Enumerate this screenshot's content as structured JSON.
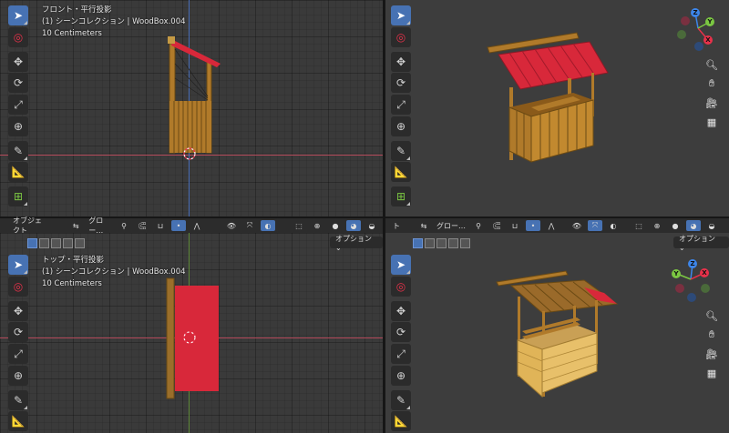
{
  "viewports": {
    "top_left": {
      "view_name": "フロント・平行投影",
      "collection": "(1) シーンコレクション | WoodBox.004",
      "scale": "10 Centimeters"
    },
    "bottom_left": {
      "view_name": "トップ・平行投影",
      "collection": "(1) シーンコレクション | WoodBox.004",
      "scale": "10 Centimeters"
    }
  },
  "header": {
    "mode_label": "オブジェクト",
    "mode_label_short": "ト",
    "orientation_label": "グロー…",
    "options_label": "オプション ⌄"
  },
  "gizmo": {
    "z": "Z",
    "y": "Y",
    "x": "X"
  },
  "colors": {
    "accent": "#4772b3",
    "roof": "#d8283a",
    "wood": "#b07a2a",
    "x_axis": "#e8314a",
    "y_axis": "#7bc742",
    "z_axis": "#3d86ea"
  }
}
